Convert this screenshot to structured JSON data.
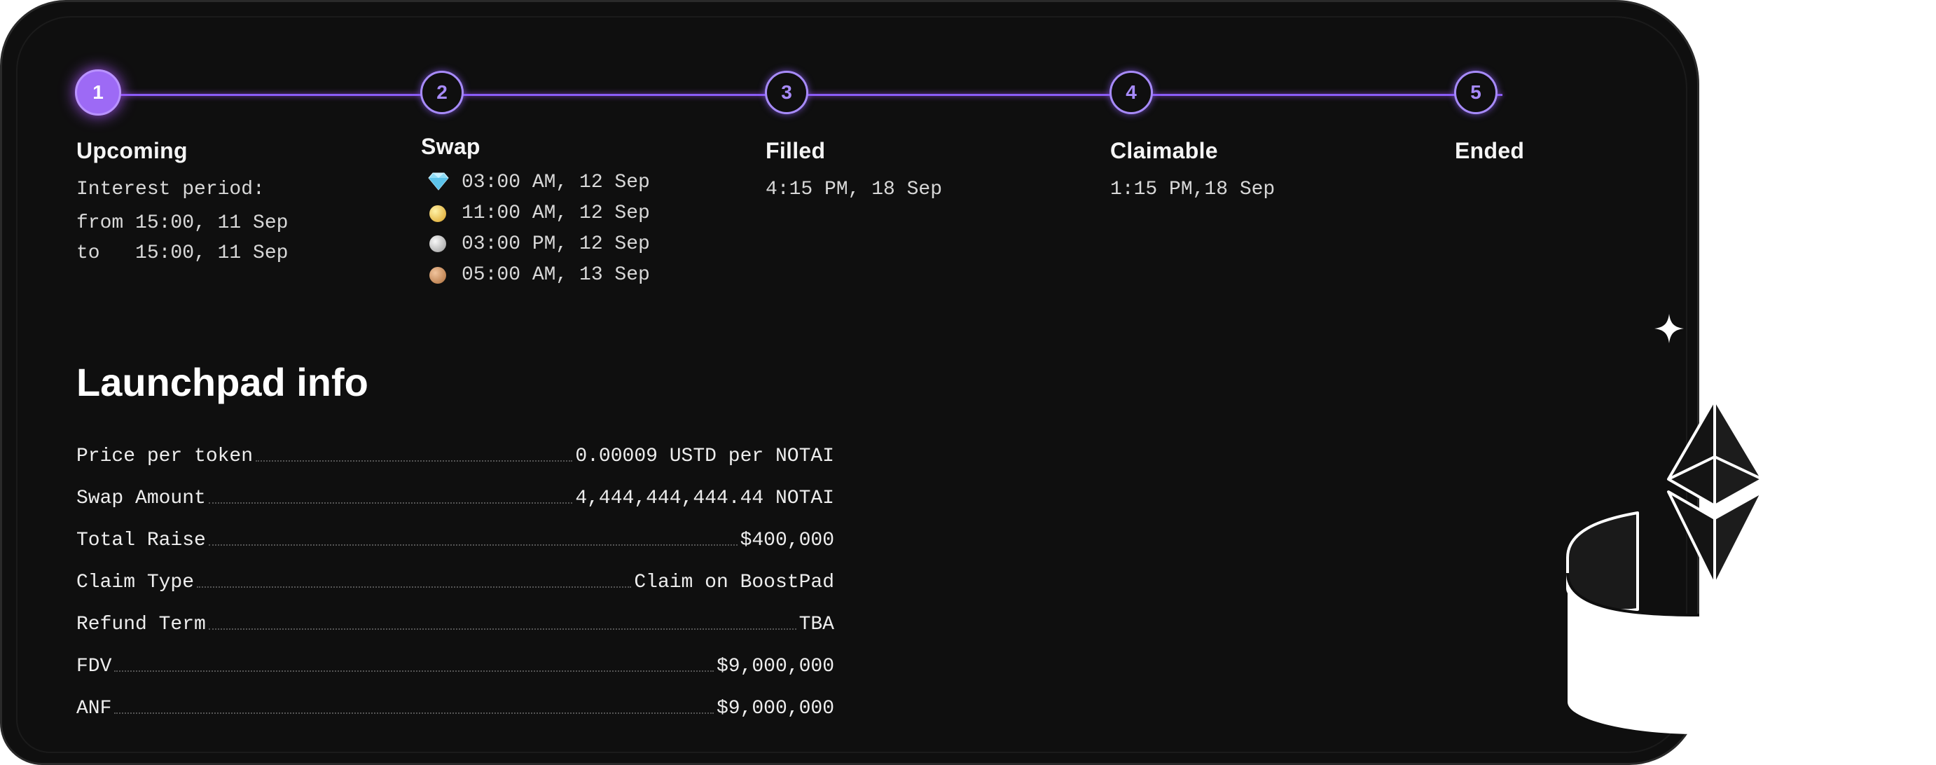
{
  "steps": [
    {
      "num": "1",
      "title": "Upcoming"
    },
    {
      "num": "2",
      "title": "Swap"
    },
    {
      "num": "3",
      "title": "Filled"
    },
    {
      "num": "4",
      "title": "Claimable"
    },
    {
      "num": "5",
      "title": "Ended"
    }
  ],
  "upcoming": {
    "label": "Interest period:",
    "from": "from 15:00, 11 Sep",
    "to": "to   15:00, 11 Sep"
  },
  "swap": {
    "rounds": [
      {
        "tier_icon": "diamond-icon",
        "time": "03:00 AM, 12 Sep"
      },
      {
        "tier_icon": "gold-medal-icon",
        "time": "11:00 AM, 12 Sep"
      },
      {
        "tier_icon": "silver-medal-icon",
        "time": "03:00 PM, 12 Sep"
      },
      {
        "tier_icon": "bronze-medal-icon",
        "time": "05:00 AM, 13 Sep"
      }
    ]
  },
  "filled": {
    "time": "4:15 PM, 18 Sep"
  },
  "claimable": {
    "time": "1:15 PM,18 Sep"
  },
  "info": {
    "title": "Launchpad info",
    "rows": [
      {
        "key": "Price per token",
        "value": "0.00009 USTD per NOTAI"
      },
      {
        "key": "Swap Amount",
        "value": "4,444,444,444.44 NOTAI"
      },
      {
        "key": "Total Raise",
        "value": "$400,000"
      },
      {
        "key": "Claim Type",
        "value": "Claim on BoostPad"
      },
      {
        "key": "Refund Term",
        "value": "TBA"
      },
      {
        "key": "FDV",
        "value": "$9,000,000"
      },
      {
        "key": "ANF",
        "value": "$9,000,000"
      }
    ]
  },
  "colors": {
    "accent": "#8b5cf6",
    "card_bg": "#0f0f0f",
    "page_bg": "#ffffff"
  }
}
